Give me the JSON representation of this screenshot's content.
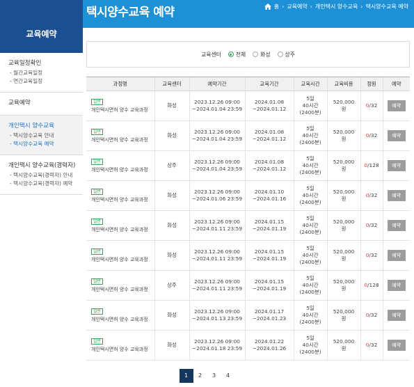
{
  "header": {
    "title": "택시양수교육 예약",
    "breadcrumb": [
      "홈",
      "교육예약",
      "개인택시 양수교육",
      "택시양수교육 예약"
    ]
  },
  "sidebar": {
    "title": "교육예약",
    "groups": [
      {
        "title": "교육일정확인",
        "items": [
          "- 월간교육일정",
          "- 연간교육일정"
        ]
      },
      {
        "title": "교육예약",
        "items": []
      },
      {
        "title": "개인택시 양수교육",
        "items": [
          "- 택시양수교육 안내",
          "- 택시양수교육 예약"
        ]
      },
      {
        "title": "개인택시 양수교육(경력자)",
        "items": [
          "- 택시양수교육(경력자) 안내",
          "- 택시양수교육(경력자) 예약"
        ]
      }
    ]
  },
  "filter": {
    "label": "교육센터",
    "options": [
      "전체",
      "화성",
      "상주"
    ],
    "selected": "전체"
  },
  "table": {
    "headers": [
      "과정명",
      "교육센터",
      "예약기간",
      "교육기간",
      "교육시간",
      "교육비용",
      "정원",
      "예약"
    ],
    "rows": [
      {
        "badge": "일반",
        "course": "개인택시면허 양수 교육과정",
        "center": "화성",
        "res1": "2023.12.26 09:00",
        "res2": "~2024.01.04 23:59",
        "edu1": "2024.01.08",
        "edu2": "~2024.01.12",
        "t1": "5일",
        "t2": "40시간",
        "t3": "(2400분)",
        "fee1": "520,000",
        "fee2": "원",
        "taken": "0",
        "cap": "/32",
        "btn": "예약"
      },
      {
        "badge": "일반",
        "course": "개인택시면허 양수 교육과정",
        "center": "화성",
        "res1": "2023.12.26 09:00",
        "res2": "~2024.01.04 23:59",
        "edu1": "2024.01.08",
        "edu2": "~2024.01.12",
        "t1": "5일",
        "t2": "40시간",
        "t3": "(2400분)",
        "fee1": "520,000",
        "fee2": "원",
        "taken": "0",
        "cap": "/32",
        "btn": "예약"
      },
      {
        "badge": "일반",
        "course": "개인택시면허 양수 교육과정",
        "center": "상주",
        "res1": "2023.12.26 09:00",
        "res2": "~2024.01.04 23:59",
        "edu1": "2024.01.08",
        "edu2": "~2024.01.12",
        "t1": "5일",
        "t2": "40시간",
        "t3": "(2400분)",
        "fee1": "520,000",
        "fee2": "원",
        "taken": "0",
        "cap": "/128",
        "btn": "예약"
      },
      {
        "badge": "일반",
        "course": "개인택시면허 양수 교육과정",
        "center": "화성",
        "res1": "2023.12.26 09:00",
        "res2": "~2024.01.06 23:59",
        "edu1": "2024.01.10",
        "edu2": "~2024.01.16",
        "t1": "5일",
        "t2": "40시간",
        "t3": "(2400분)",
        "fee1": "520,000",
        "fee2": "원",
        "taken": "0",
        "cap": "/32",
        "btn": "예약"
      },
      {
        "badge": "일반",
        "course": "개인택시면허 양수 교육과정",
        "center": "화성",
        "res1": "2023.12.26 09:00",
        "res2": "~2024.01.11 23:59",
        "edu1": "2024.01.15",
        "edu2": "~2024.01.19",
        "t1": "5일",
        "t2": "40시간",
        "t3": "(2400분)",
        "fee1": "520,000",
        "fee2": "원",
        "taken": "0",
        "cap": "/32",
        "btn": "예약"
      },
      {
        "badge": "일반",
        "course": "개인택시면허 양수 교육과정",
        "center": "화성",
        "res1": "2023.12.26 09:00",
        "res2": "~2024.01.11 23:59",
        "edu1": "2024.01.15",
        "edu2": "~2024.01.19",
        "t1": "5일",
        "t2": "40시간",
        "t3": "(2400분)",
        "fee1": "520,000",
        "fee2": "원",
        "taken": "0",
        "cap": "/32",
        "btn": "예약"
      },
      {
        "badge": "일반",
        "course": "개인택시면허 양수 교육과정",
        "center": "상주",
        "res1": "2023.12.26 09:00",
        "res2": "~2024.01.11 23:59",
        "edu1": "2024.01.15",
        "edu2": "~2024.01.19",
        "t1": "5일",
        "t2": "40시간",
        "t3": "(2400분)",
        "fee1": "520,000",
        "fee2": "원",
        "taken": "0",
        "cap": "/128",
        "btn": "예약"
      },
      {
        "badge": "일반",
        "course": "개인택시면허 양수 교육과정",
        "center": "화성",
        "res1": "2023.12.26 09:00",
        "res2": "~2024.01.13 23:59",
        "edu1": "2024.01.17",
        "edu2": "~2024.01.23",
        "t1": "5일",
        "t2": "40시간",
        "t3": "(2400분)",
        "fee1": "520,000",
        "fee2": "원",
        "taken": "0",
        "cap": "/32",
        "btn": "예약"
      },
      {
        "badge": "일반",
        "course": "개인택시면허 양수 교육과정",
        "center": "화성",
        "res1": "2023.12.26 09:00",
        "res2": "~2024.01.18 23:59",
        "edu1": "2024.01.22",
        "edu2": "~2024.01.26",
        "t1": "5일",
        "t2": "40시간",
        "t3": "(2400분)",
        "fee1": "520,000",
        "fee2": "원",
        "taken": "0",
        "cap": "/32",
        "btn": "예약"
      }
    ]
  },
  "pagination": {
    "pages": [
      "1",
      "2",
      "3",
      "4"
    ],
    "current": "1"
  },
  "colors": {
    "topbar": "#1e90d6",
    "sidebar_head": "#1a4f91",
    "accent_green": "#3aa15a",
    "zero_red": "#e03a3a",
    "page_active": "#14365f"
  }
}
